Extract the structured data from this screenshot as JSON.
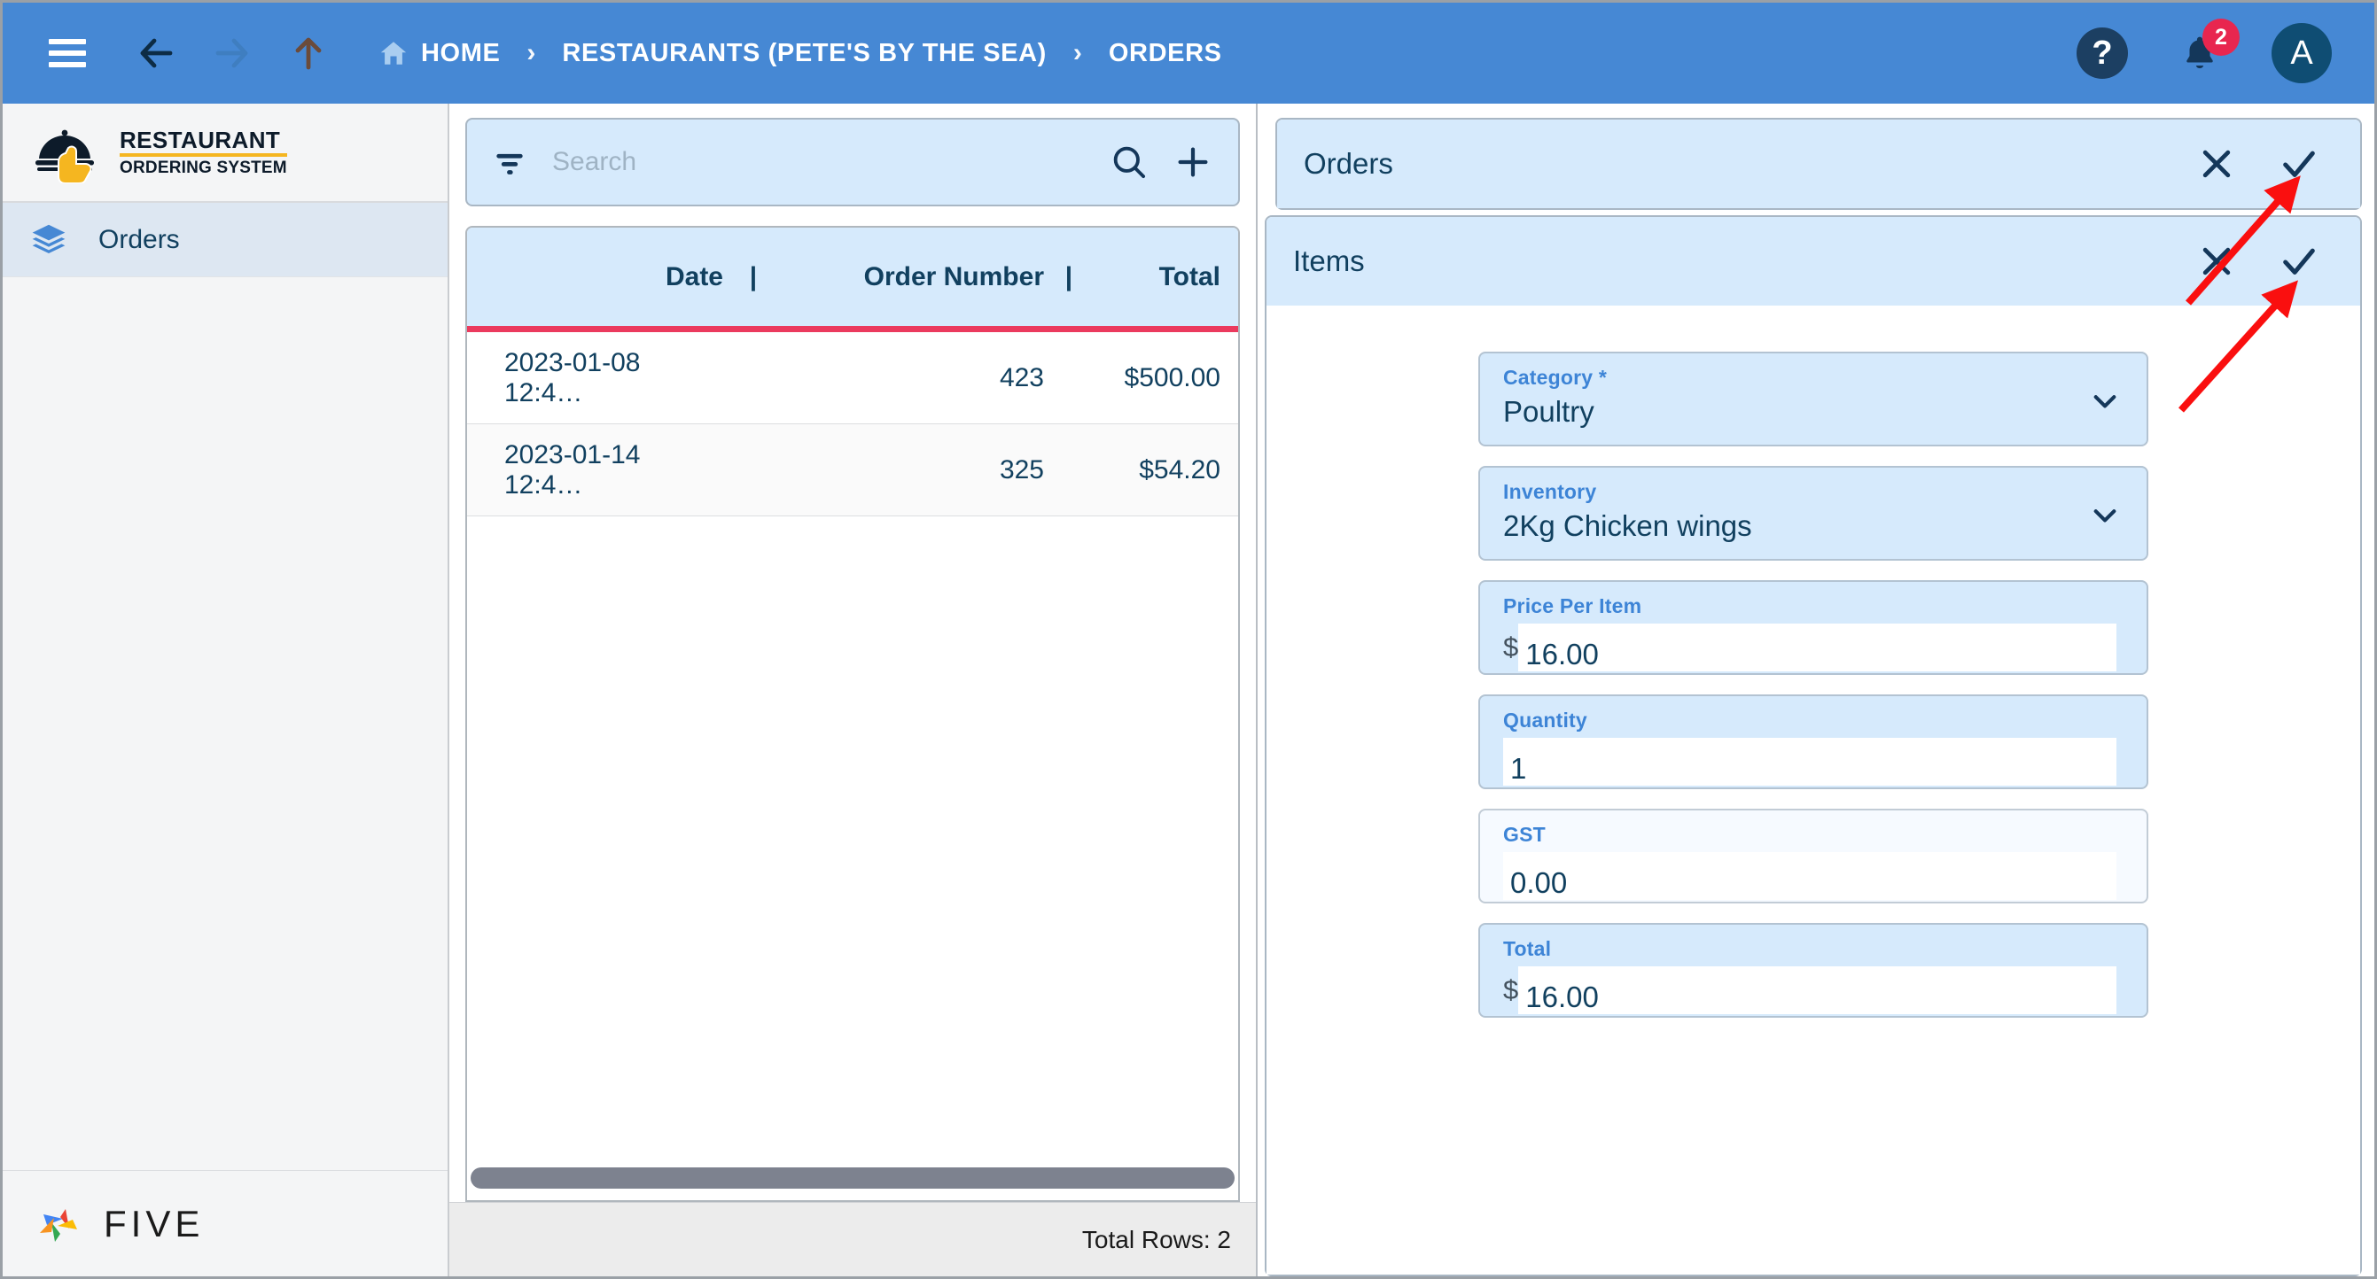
{
  "header": {
    "menu_icon": "hamburger-icon",
    "back_icon": "arrow-left-icon",
    "forward_icon": "arrow-right-icon",
    "up_icon": "arrow-up-icon",
    "breadcrumb": [
      {
        "label": "HOME",
        "icon": "home-icon"
      },
      {
        "label": "RESTAURANTS (PETE'S BY THE SEA)",
        "icon": ""
      },
      {
        "label": "ORDERS",
        "icon": ""
      }
    ],
    "separator": "›",
    "help_label": "?",
    "notification_count": "2",
    "avatar_initial": "A",
    "bar_color": "#4688d4"
  },
  "sidebar": {
    "logo": {
      "line1": "RESTAURANT",
      "line2": "ORDERING SYSTEM",
      "accent": "#f5b620"
    },
    "items": [
      {
        "label": "Orders",
        "icon": "layers-icon",
        "active": true
      }
    ],
    "footer_logo": {
      "text": "FIVE",
      "colors": [
        "#4285f4",
        "#ea4335",
        "#fbbc05",
        "#34a853",
        "#f79421"
      ]
    }
  },
  "list_panel": {
    "search": {
      "placeholder": "Search",
      "value": "",
      "filter_icon": "filter-icon",
      "search_icon": "search-icon",
      "add_icon": "plus-icon"
    },
    "columns": [
      "Date",
      "Order Number",
      "Total"
    ],
    "column_separator": "|",
    "rows": [
      {
        "date": "2023-01-08 12:4…",
        "order_number": "423",
        "total": "$500.00"
      },
      {
        "date": "2023-01-14 12:4…",
        "order_number": "325",
        "total": "$54.20"
      }
    ],
    "footer": "Total Rows: 2",
    "header_underline_color": "#eb3a5e"
  },
  "detail": {
    "orders_panel": {
      "title": "Orders",
      "close_icon": "close-icon",
      "save_icon": "check-icon"
    },
    "items_panel": {
      "title": "Items",
      "close_icon": "close-icon",
      "save_icon": "check-icon"
    },
    "fields": [
      {
        "label": "Category *",
        "value": "Poultry",
        "type": "dropdown",
        "currency": "",
        "align": "left",
        "readonly": false
      },
      {
        "label": "Inventory",
        "value": "2Kg Chicken wings",
        "type": "dropdown",
        "currency": "",
        "align": "left",
        "readonly": false
      },
      {
        "label": "Price Per Item",
        "value": "16.00",
        "type": "currency",
        "currency": "$",
        "align": "right",
        "readonly": false
      },
      {
        "label": "Quantity",
        "value": "1",
        "type": "number",
        "currency": "",
        "align": "right",
        "readonly": false
      },
      {
        "label": "GST",
        "value": "0.00",
        "type": "number",
        "currency": "",
        "align": "right",
        "readonly": true
      },
      {
        "label": "Total",
        "value": "16.00",
        "type": "currency",
        "currency": "$",
        "align": "right",
        "readonly": false
      }
    ]
  },
  "annotations": {
    "arrow_color": "#fa0f0f",
    "arrows": [
      {
        "target": "orders-save-icon"
      },
      {
        "target": "items-save-icon"
      }
    ]
  }
}
